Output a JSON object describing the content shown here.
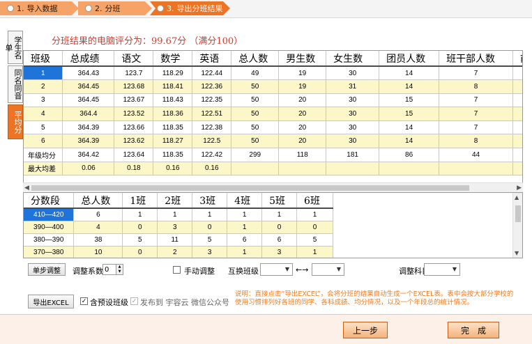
{
  "steps": [
    {
      "num": "1.",
      "label": "导入数据"
    },
    {
      "num": "2.",
      "label": "分班"
    },
    {
      "num": "3.",
      "label": "导出分班结果"
    }
  ],
  "side_tabs": [
    "学生名单",
    "同名同音",
    "平均分"
  ],
  "score_title": "分班结果的电脑评分为：99.67分 （满分100）",
  "main_table": {
    "headers": [
      "班级",
      "总成绩",
      "语文",
      "数学",
      "英语",
      "总人数",
      "男生数",
      "女生数",
      "团员人数",
      "班干部人数",
      "前"
    ],
    "rows": [
      [
        "1",
        "364.43",
        "123.7",
        "118.29",
        "122.44",
        "49",
        "19",
        "30",
        "14",
        "7",
        ""
      ],
      [
        "2",
        "364.45",
        "123.68",
        "118.41",
        "122.36",
        "50",
        "19",
        "31",
        "14",
        "8",
        ""
      ],
      [
        "3",
        "364.45",
        "123.67",
        "118.43",
        "122.35",
        "50",
        "20",
        "30",
        "15",
        "7",
        ""
      ],
      [
        "4",
        "364.4",
        "123.52",
        "118.36",
        "122.51",
        "50",
        "20",
        "30",
        "15",
        "7",
        ""
      ],
      [
        "5",
        "364.39",
        "123.66",
        "118.35",
        "122.38",
        "50",
        "20",
        "30",
        "14",
        "7",
        ""
      ],
      [
        "6",
        "364.39",
        "123.62",
        "118.27",
        "122.5",
        "50",
        "20",
        "30",
        "14",
        "8",
        ""
      ],
      [
        "年级均分",
        "364.42",
        "123.64",
        "118.35",
        "122.42",
        "299",
        "118",
        "181",
        "86",
        "44",
        ""
      ],
      [
        "最大均差",
        "0.06",
        "0.18",
        "0.16",
        "0.16",
        "",
        "",
        "",
        "",
        "",
        ""
      ]
    ]
  },
  "score_table": {
    "headers": [
      "分数段",
      "总人数",
      "1班",
      "2班",
      "3班",
      "4班",
      "5班",
      "6班"
    ],
    "rows": [
      [
        "410—420",
        "6",
        "1",
        "1",
        "1",
        "1",
        "1",
        "1"
      ],
      [
        "390—400",
        "4",
        "0",
        "3",
        "0",
        "1",
        "0",
        "0"
      ],
      [
        "380—390",
        "38",
        "5",
        "11",
        "5",
        "6",
        "6",
        "5"
      ],
      [
        "370—380",
        "10",
        "0",
        "2",
        "3",
        "1",
        "3",
        "1"
      ]
    ]
  },
  "controls": {
    "single_step": "单步调整",
    "adjust_coef_label": "调整系数",
    "adjust_coef_value": "0",
    "manual_adjust": "手动调整",
    "swap_class": "互换班级",
    "swap_arrow": "←→",
    "adjust_subject": "调整科目",
    "export_excel": "导出EXCEL",
    "include_preset": "含预设班级",
    "publish": "发布到 宇容云 微信公众号",
    "note": "说明：直接点击“导出EXCEL”，会将分班的结果自动生成一个EXCEL表。表中会按大部分学校的使用习惯排列好各班的同学、各科成绩、均分情况，以及一个年段总的统计情况。"
  },
  "footer": {
    "prev": "上一步",
    "finish": "完　成"
  }
}
